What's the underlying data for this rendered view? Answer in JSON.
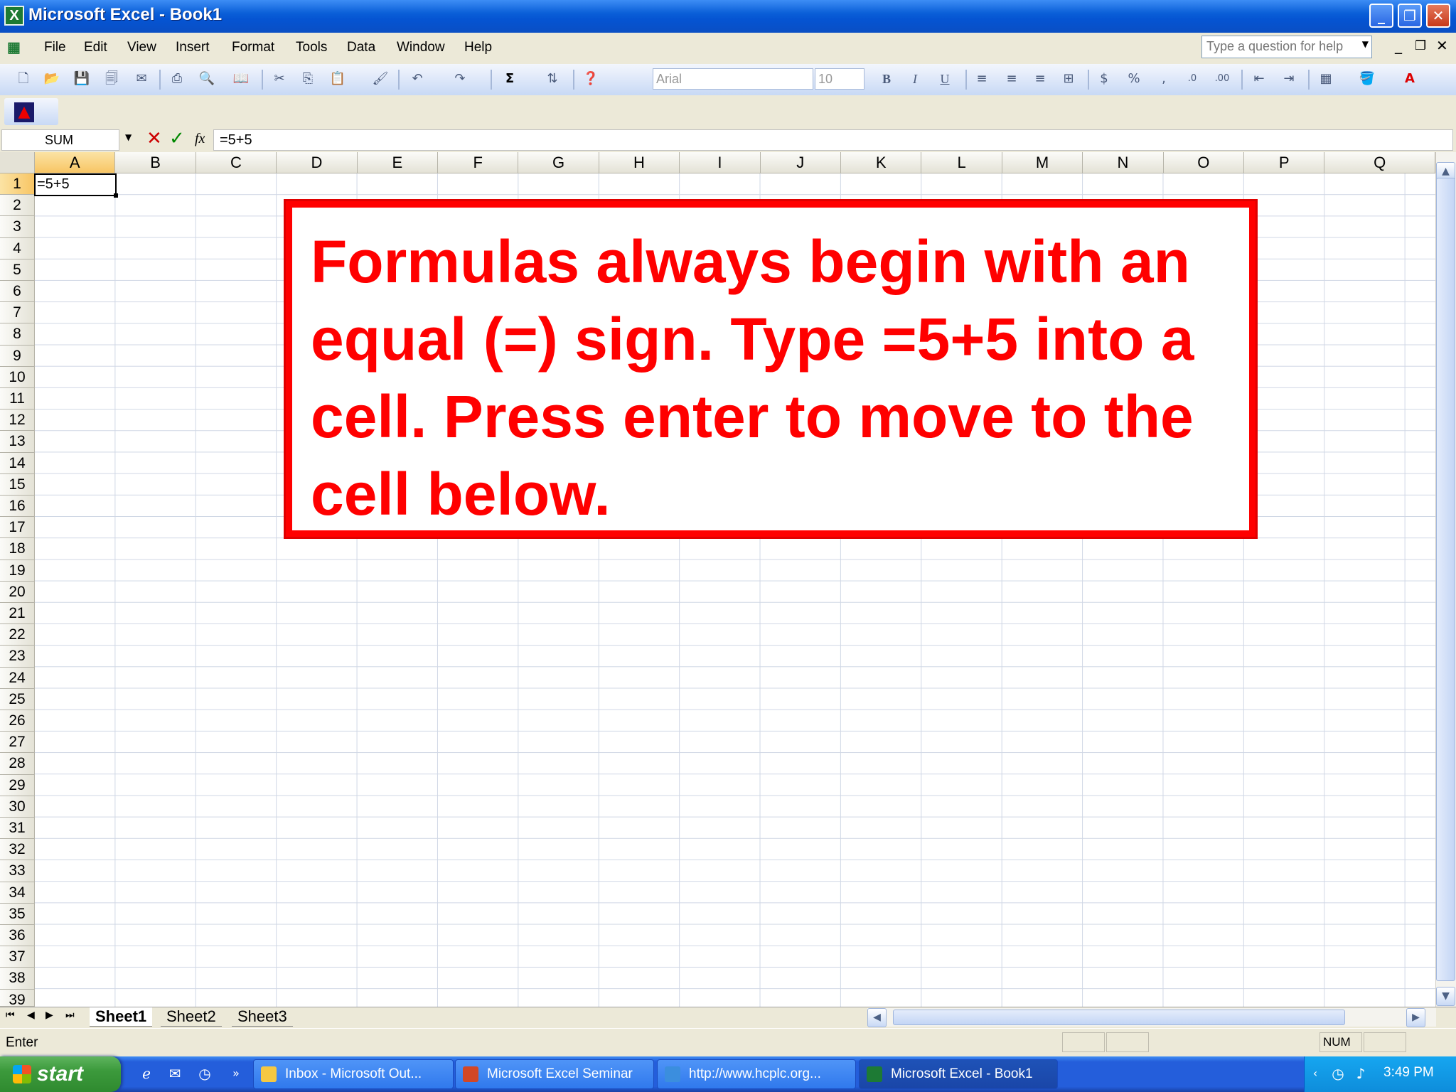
{
  "window": {
    "title": "Microsoft Excel - Book1",
    "app_icon": "X"
  },
  "menu": [
    "File",
    "Edit",
    "View",
    "Insert",
    "Format",
    "Tools",
    "Data",
    "Window",
    "Help"
  ],
  "help_search": {
    "placeholder": "Type a question for help"
  },
  "toolbar": {
    "font_name": "Arial",
    "font_size": "10"
  },
  "formula_bar": {
    "name_box": "SUM",
    "formula": "=5+5",
    "fx_label": "fx"
  },
  "columns": [
    "A",
    "B",
    "C",
    "D",
    "E",
    "F",
    "G",
    "H",
    "I",
    "J",
    "K",
    "L",
    "M",
    "N",
    "O",
    "P",
    "Q"
  ],
  "rows": [
    "1",
    "2",
    "3",
    "4",
    "5",
    "6",
    "7",
    "8",
    "9",
    "10",
    "11",
    "12",
    "13",
    "14",
    "15",
    "16",
    "17",
    "18",
    "19",
    "20",
    "21",
    "22",
    "23",
    "24",
    "25",
    "26",
    "27",
    "28",
    "29",
    "30",
    "31",
    "32",
    "33",
    "34",
    "35",
    "36",
    "37",
    "38",
    "39"
  ],
  "active_cell": {
    "ref": "A1",
    "value": "=5+5"
  },
  "callout": {
    "text": "Formulas always begin with an equal (=) sign.  Type =5+5 into a cell.  Press enter to move to the cell below.",
    "color": "#ff0000"
  },
  "sheet_tabs": [
    "Sheet1",
    "Sheet2",
    "Sheet3"
  ],
  "active_sheet": "Sheet1",
  "status": {
    "mode": "Enter",
    "num_indicator": "NUM"
  },
  "taskbar": {
    "start_label": "start",
    "tasks": [
      {
        "label": "Inbox - Microsoft Out...",
        "icon": "outlook-icon"
      },
      {
        "label": "Microsoft Excel Seminar",
        "icon": "powerpoint-icon"
      },
      {
        "label": "http://www.hcplc.org...",
        "icon": "ie-icon"
      },
      {
        "label": "Microsoft Excel - Book1",
        "icon": "excel-icon"
      }
    ],
    "clock": "3:49 PM"
  }
}
